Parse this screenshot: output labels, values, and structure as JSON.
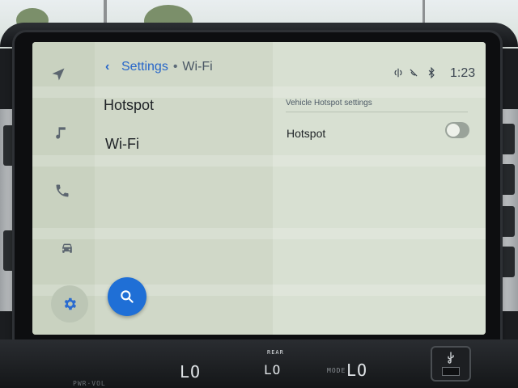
{
  "breadcrumb": {
    "back_icon": "chevron-left-icon",
    "parent": "Settings",
    "separator": "•",
    "current": "Wi-Fi"
  },
  "list": {
    "items": [
      {
        "label": "Hotspot"
      },
      {
        "label": "Wi-Fi"
      }
    ]
  },
  "rail": {
    "items": [
      {
        "icon": "navigation-icon"
      },
      {
        "icon": "music-icon"
      },
      {
        "icon": "phone-icon"
      },
      {
        "icon": "car-icon"
      },
      {
        "icon": "gear-icon",
        "active": true
      }
    ]
  },
  "search": {
    "icon": "search-icon"
  },
  "status_bar": {
    "icons": [
      "wireless-charging-icon",
      "phone-muted-icon",
      "bluetooth-icon"
    ],
    "time": "1:23"
  },
  "detail": {
    "section_title": "Vehicle Hotspot settings",
    "rows": [
      {
        "label": "Hotspot",
        "enabled": false
      }
    ]
  },
  "climate": {
    "left_temp": "LO",
    "right_temp": "LO",
    "rear_label": "REAR",
    "mode_label": "MODE",
    "pwr_label": "PWR·VOL"
  },
  "colors": {
    "accent": "#1f6fd6",
    "link": "#2766c9"
  }
}
